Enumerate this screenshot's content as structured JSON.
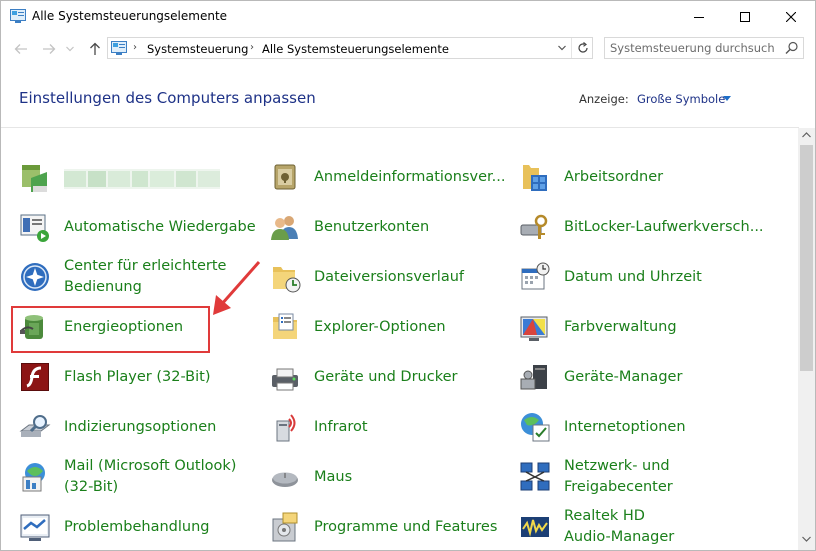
{
  "window": {
    "title": "Alle Systemsteuerungselemente"
  },
  "address": {
    "crumbs": [
      "Systemsteuerung",
      "Alle Systemsteuerungselemente"
    ]
  },
  "search": {
    "placeholder": "Systemsteuerung durchsuchen"
  },
  "header": {
    "heading": "Einstellungen des Computers anpassen",
    "view_label": "Anzeige:",
    "view_value": "Große Symbole"
  },
  "colors": {
    "link_green": "#1a7f1a",
    "heading_blue": "#1e3287",
    "highlight_red": "#e03a3a"
  },
  "items": {
    "col1": [
      {
        "label": "",
        "icon": "blurred-app-icon"
      },
      {
        "label": "Automatische Wiedergabe",
        "icon": "autoplay-icon"
      },
      {
        "label": "Center für erleichterte\nBedienung",
        "icon": "ease-of-access-icon"
      },
      {
        "label": "Energieoptionen",
        "icon": "power-options-icon"
      },
      {
        "label": "Flash Player (32-Bit)",
        "icon": "flash-icon"
      },
      {
        "label": "Indizierungsoptionen",
        "icon": "indexing-icon"
      },
      {
        "label": "Mail (Microsoft Outlook)\n(32-Bit)",
        "icon": "mail-icon"
      },
      {
        "label": "Problembehandlung",
        "icon": "troubleshooting-icon"
      }
    ],
    "col2": [
      {
        "label": "Anmeldeinformationsver...",
        "icon": "credential-manager-icon"
      },
      {
        "label": "Benutzerkonten",
        "icon": "user-accounts-icon"
      },
      {
        "label": "Dateiversionsverlauf",
        "icon": "file-history-icon"
      },
      {
        "label": "Explorer-Optionen",
        "icon": "explorer-options-icon"
      },
      {
        "label": "Geräte und Drucker",
        "icon": "devices-printers-icon"
      },
      {
        "label": "Infrarot",
        "icon": "infrared-icon"
      },
      {
        "label": "Maus",
        "icon": "mouse-icon"
      },
      {
        "label": "Programme und Features",
        "icon": "programs-features-icon"
      }
    ],
    "col3": [
      {
        "label": "Arbeitsordner",
        "icon": "work-folders-icon"
      },
      {
        "label": "BitLocker-Laufwerkversch...",
        "icon": "bitlocker-icon"
      },
      {
        "label": "Datum und Uhrzeit",
        "icon": "date-time-icon"
      },
      {
        "label": "Farbverwaltung",
        "icon": "color-management-icon"
      },
      {
        "label": "Geräte-Manager",
        "icon": "device-manager-icon"
      },
      {
        "label": "Internetoptionen",
        "icon": "internet-options-icon"
      },
      {
        "label": "Netzwerk- und\nFreigabecenter",
        "icon": "network-sharing-icon"
      },
      {
        "label": "Realtek HD\nAudio-Manager",
        "icon": "realtek-audio-icon"
      }
    ]
  }
}
